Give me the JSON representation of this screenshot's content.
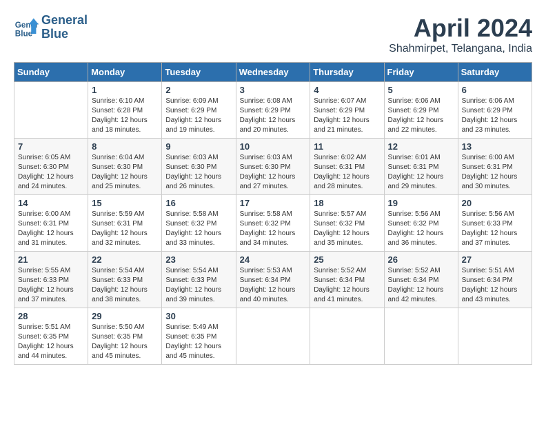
{
  "header": {
    "logo_line1": "General",
    "logo_line2": "Blue",
    "month_year": "April 2024",
    "location": "Shahmirpet, Telangana, India"
  },
  "columns": [
    "Sunday",
    "Monday",
    "Tuesday",
    "Wednesday",
    "Thursday",
    "Friday",
    "Saturday"
  ],
  "weeks": [
    [
      {
        "day": "",
        "info": ""
      },
      {
        "day": "1",
        "info": "Sunrise: 6:10 AM\nSunset: 6:28 PM\nDaylight: 12 hours\nand 18 minutes."
      },
      {
        "day": "2",
        "info": "Sunrise: 6:09 AM\nSunset: 6:29 PM\nDaylight: 12 hours\nand 19 minutes."
      },
      {
        "day": "3",
        "info": "Sunrise: 6:08 AM\nSunset: 6:29 PM\nDaylight: 12 hours\nand 20 minutes."
      },
      {
        "day": "4",
        "info": "Sunrise: 6:07 AM\nSunset: 6:29 PM\nDaylight: 12 hours\nand 21 minutes."
      },
      {
        "day": "5",
        "info": "Sunrise: 6:06 AM\nSunset: 6:29 PM\nDaylight: 12 hours\nand 22 minutes."
      },
      {
        "day": "6",
        "info": "Sunrise: 6:06 AM\nSunset: 6:29 PM\nDaylight: 12 hours\nand 23 minutes."
      }
    ],
    [
      {
        "day": "7",
        "info": "Sunrise: 6:05 AM\nSunset: 6:30 PM\nDaylight: 12 hours\nand 24 minutes."
      },
      {
        "day": "8",
        "info": "Sunrise: 6:04 AM\nSunset: 6:30 PM\nDaylight: 12 hours\nand 25 minutes."
      },
      {
        "day": "9",
        "info": "Sunrise: 6:03 AM\nSunset: 6:30 PM\nDaylight: 12 hours\nand 26 minutes."
      },
      {
        "day": "10",
        "info": "Sunrise: 6:03 AM\nSunset: 6:30 PM\nDaylight: 12 hours\nand 27 minutes."
      },
      {
        "day": "11",
        "info": "Sunrise: 6:02 AM\nSunset: 6:31 PM\nDaylight: 12 hours\nand 28 minutes."
      },
      {
        "day": "12",
        "info": "Sunrise: 6:01 AM\nSunset: 6:31 PM\nDaylight: 12 hours\nand 29 minutes."
      },
      {
        "day": "13",
        "info": "Sunrise: 6:00 AM\nSunset: 6:31 PM\nDaylight: 12 hours\nand 30 minutes."
      }
    ],
    [
      {
        "day": "14",
        "info": "Sunrise: 6:00 AM\nSunset: 6:31 PM\nDaylight: 12 hours\nand 31 minutes."
      },
      {
        "day": "15",
        "info": "Sunrise: 5:59 AM\nSunset: 6:31 PM\nDaylight: 12 hours\nand 32 minutes."
      },
      {
        "day": "16",
        "info": "Sunrise: 5:58 AM\nSunset: 6:32 PM\nDaylight: 12 hours\nand 33 minutes."
      },
      {
        "day": "17",
        "info": "Sunrise: 5:58 AM\nSunset: 6:32 PM\nDaylight: 12 hours\nand 34 minutes."
      },
      {
        "day": "18",
        "info": "Sunrise: 5:57 AM\nSunset: 6:32 PM\nDaylight: 12 hours\nand 35 minutes."
      },
      {
        "day": "19",
        "info": "Sunrise: 5:56 AM\nSunset: 6:32 PM\nDaylight: 12 hours\nand 36 minutes."
      },
      {
        "day": "20",
        "info": "Sunrise: 5:56 AM\nSunset: 6:33 PM\nDaylight: 12 hours\nand 37 minutes."
      }
    ],
    [
      {
        "day": "21",
        "info": "Sunrise: 5:55 AM\nSunset: 6:33 PM\nDaylight: 12 hours\nand 37 minutes."
      },
      {
        "day": "22",
        "info": "Sunrise: 5:54 AM\nSunset: 6:33 PM\nDaylight: 12 hours\nand 38 minutes."
      },
      {
        "day": "23",
        "info": "Sunrise: 5:54 AM\nSunset: 6:33 PM\nDaylight: 12 hours\nand 39 minutes."
      },
      {
        "day": "24",
        "info": "Sunrise: 5:53 AM\nSunset: 6:34 PM\nDaylight: 12 hours\nand 40 minutes."
      },
      {
        "day": "25",
        "info": "Sunrise: 5:52 AM\nSunset: 6:34 PM\nDaylight: 12 hours\nand 41 minutes."
      },
      {
        "day": "26",
        "info": "Sunrise: 5:52 AM\nSunset: 6:34 PM\nDaylight: 12 hours\nand 42 minutes."
      },
      {
        "day": "27",
        "info": "Sunrise: 5:51 AM\nSunset: 6:34 PM\nDaylight: 12 hours\nand 43 minutes."
      }
    ],
    [
      {
        "day": "28",
        "info": "Sunrise: 5:51 AM\nSunset: 6:35 PM\nDaylight: 12 hours\nand 44 minutes."
      },
      {
        "day": "29",
        "info": "Sunrise: 5:50 AM\nSunset: 6:35 PM\nDaylight: 12 hours\nand 45 minutes."
      },
      {
        "day": "30",
        "info": "Sunrise: 5:49 AM\nSunset: 6:35 PM\nDaylight: 12 hours\nand 45 minutes."
      },
      {
        "day": "",
        "info": ""
      },
      {
        "day": "",
        "info": ""
      },
      {
        "day": "",
        "info": ""
      },
      {
        "day": "",
        "info": ""
      }
    ]
  ]
}
